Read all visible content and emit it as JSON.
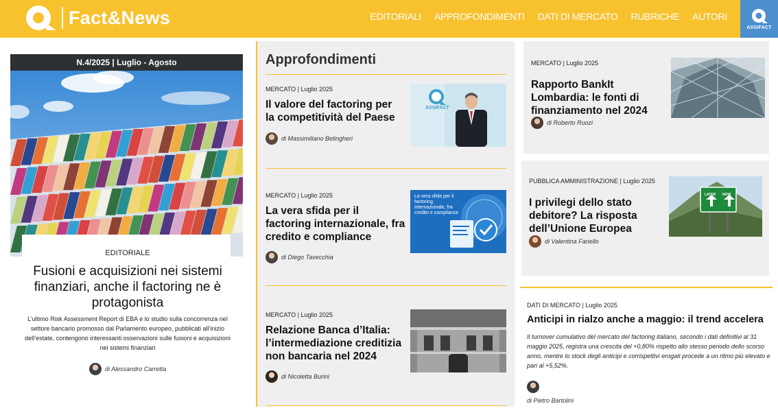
{
  "header": {
    "brand": "Fact&News",
    "nav": [
      "EDITORIALI",
      "APPROFONDIMENTI",
      "DATI DI MERCATO",
      "RUBRICHE",
      "AUTORI"
    ],
    "partner_label": "ASSIFACT",
    "brand_color": "#f8c12e",
    "partner_color": "#4b8fcf"
  },
  "editorial": {
    "issue": "N.4/2025 | Luglio - Agosto",
    "tag": "EDITORIALE",
    "title": "Fusioni e acquisizioni nei sistemi finanziari, anche il factoring ne è protagonista",
    "summary": "L’ultimo Risk Assessment Report di EBA e lo studio sulla concorrenza nel settore bancario promosso dal Parlamento europeo, pubblicati all’inizio dell’estate, contengono interessanti osservazioni sulle fusioni e acquisizioni nei sistemi finanziari",
    "author": "di Alessandro Carretta"
  },
  "approfondimenti": {
    "heading": "Approfondimenti",
    "articles": [
      {
        "meta": "MERCATO | Luglio 2025",
        "title": "Il valore del factoring per la competitività del Paese",
        "author": "di Massimiliano Belingheri",
        "thumb_text": "ASSIFACT"
      },
      {
        "meta": "MERCATO | Luglio 2025",
        "title": "La vera sfida per il factoring internazionale, fra credito e compliance",
        "author": "di Diego Tavecchia",
        "thumb_text": "La vera sfida per il factoring internazionale, fra credito e compliance"
      },
      {
        "meta": "MERCATO | Luglio 2025",
        "title": "Relazione Banca d’Italia: l’intermediazione creditizia non bancaria nel 2024",
        "author": "di Nicoletta Burini"
      }
    ]
  },
  "right": {
    "articles": [
      {
        "meta": "MERCATO | Luglio 2025",
        "title": "Rapporto BankIt Lombardia: le fonti di finanziamento nel 2024",
        "author": "di Roberto Ruozi"
      },
      {
        "meta": "PUBBLICA AMMINISTRAZIONE | Luglio 2025",
        "title": "I privilegi dello stato debitore? La risposta dell’Unione Europea",
        "author": "di Valentina Fariello",
        "sign_left": "LATER",
        "sign_right": "NOW"
      },
      {
        "meta": "DATI DI MERCATO | Luglio 2025",
        "title": "Anticipi in rialzo anche a maggio: il trend accelera",
        "summary": "Il turnover cumulativo del mercato del factoring italiano, secondo i dati definitivi al 31 maggio 2025, registra una crescita del +0,80% rispetto allo stesso periodo dello scorso anno, mentre lo stock degli anticipi e corrispettivi erogati procede a un ritmo più elevato e pari al +5,52%.",
        "author": "di Pietro Bartolini"
      }
    ]
  }
}
